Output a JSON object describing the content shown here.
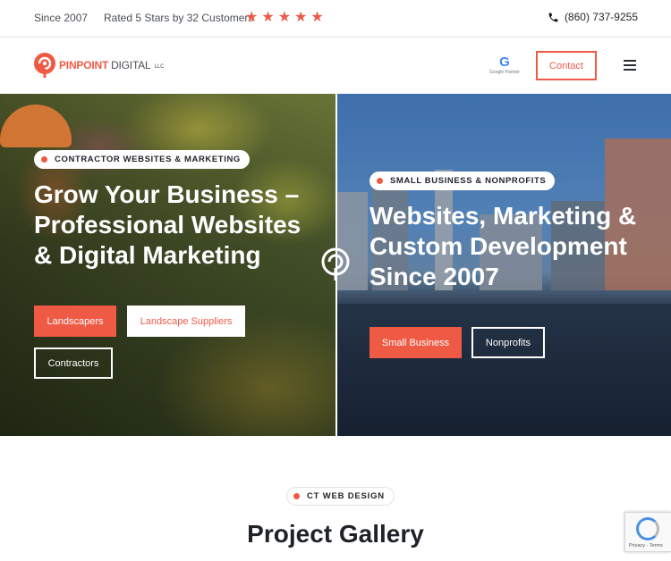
{
  "topbar": {
    "since": "Since 2007",
    "rated": "Rated 5 Stars by 32 Customers",
    "star_count": 5,
    "star_glyph": "★",
    "phone": "(860) 737-9255",
    "phone_icon": "phone-icon"
  },
  "header": {
    "logo": {
      "brand_part1": "PINPOINT",
      "brand_part2": "DIGITAL",
      "suffix": "LLC"
    },
    "google_partner": {
      "letter": "G",
      "label": "Google Partner"
    },
    "contact_label": "Contact",
    "menu_icon": "hamburger-icon"
  },
  "hero": {
    "left": {
      "badge": "CONTRACTOR WEBSITES & MARKETING",
      "title": "Grow Your Business – Professional Websites & Digital Marketing",
      "buttons": [
        "Landscapers",
        "Landscape Suppliers",
        "Contractors"
      ]
    },
    "right": {
      "badge": "SMALL BUSINESS & NONPROFITS",
      "title": "Websites, Marketing & Custom Development Since 2007",
      "buttons": [
        "Small Business",
        "Nonprofits"
      ]
    }
  },
  "section": {
    "badge": "CT WEB DESIGN",
    "title": "Project Gallery"
  },
  "recaptcha": {
    "text": "Privacy - Terms"
  },
  "colors": {
    "accent": "#ef5a45",
    "text": "#1f2329"
  }
}
